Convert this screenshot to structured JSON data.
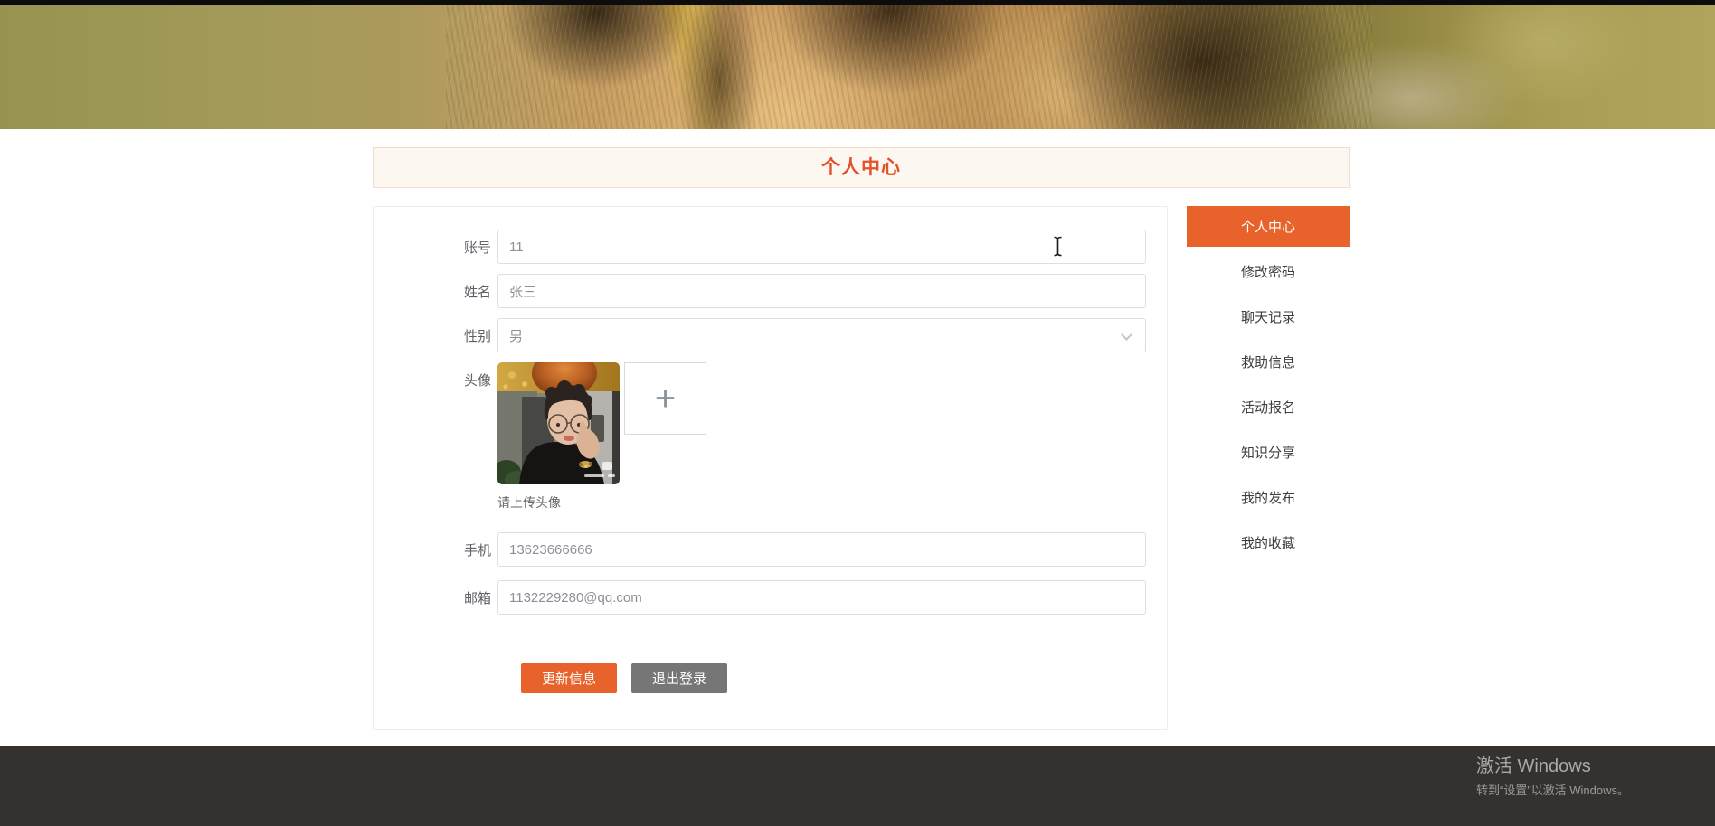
{
  "header": {
    "title": "个人中心"
  },
  "form": {
    "account": {
      "label": "账号",
      "value": "11"
    },
    "name": {
      "label": "姓名",
      "value": "张三"
    },
    "gender": {
      "label": "性别",
      "value": "男"
    },
    "avatar": {
      "label": "头像",
      "caption": "请上传头像"
    },
    "phone": {
      "label": "手机",
      "value": "13623666666"
    },
    "email": {
      "label": "邮箱",
      "value": "1132229280@qq.com"
    },
    "update_button": "更新信息",
    "logout_button": "退出登录"
  },
  "sidebar": {
    "items": [
      {
        "label": "个人中心",
        "active": true
      },
      {
        "label": "修改密码",
        "active": false
      },
      {
        "label": "聊天记录",
        "active": false
      },
      {
        "label": "救助信息",
        "active": false
      },
      {
        "label": "活动报名",
        "active": false
      },
      {
        "label": "知识分享",
        "active": false
      },
      {
        "label": "我的发布",
        "active": false
      },
      {
        "label": "我的收藏",
        "active": false
      }
    ]
  },
  "icons": {
    "upload_plus": "+"
  },
  "watermark": {
    "line1": "激活 Windows",
    "line2": "转到“设置”以激活 Windows。"
  },
  "colors": {
    "accent": "#e8622b",
    "gray_button": "#767676",
    "footer_bg": "#34312f",
    "title_text": "#e4512a"
  }
}
